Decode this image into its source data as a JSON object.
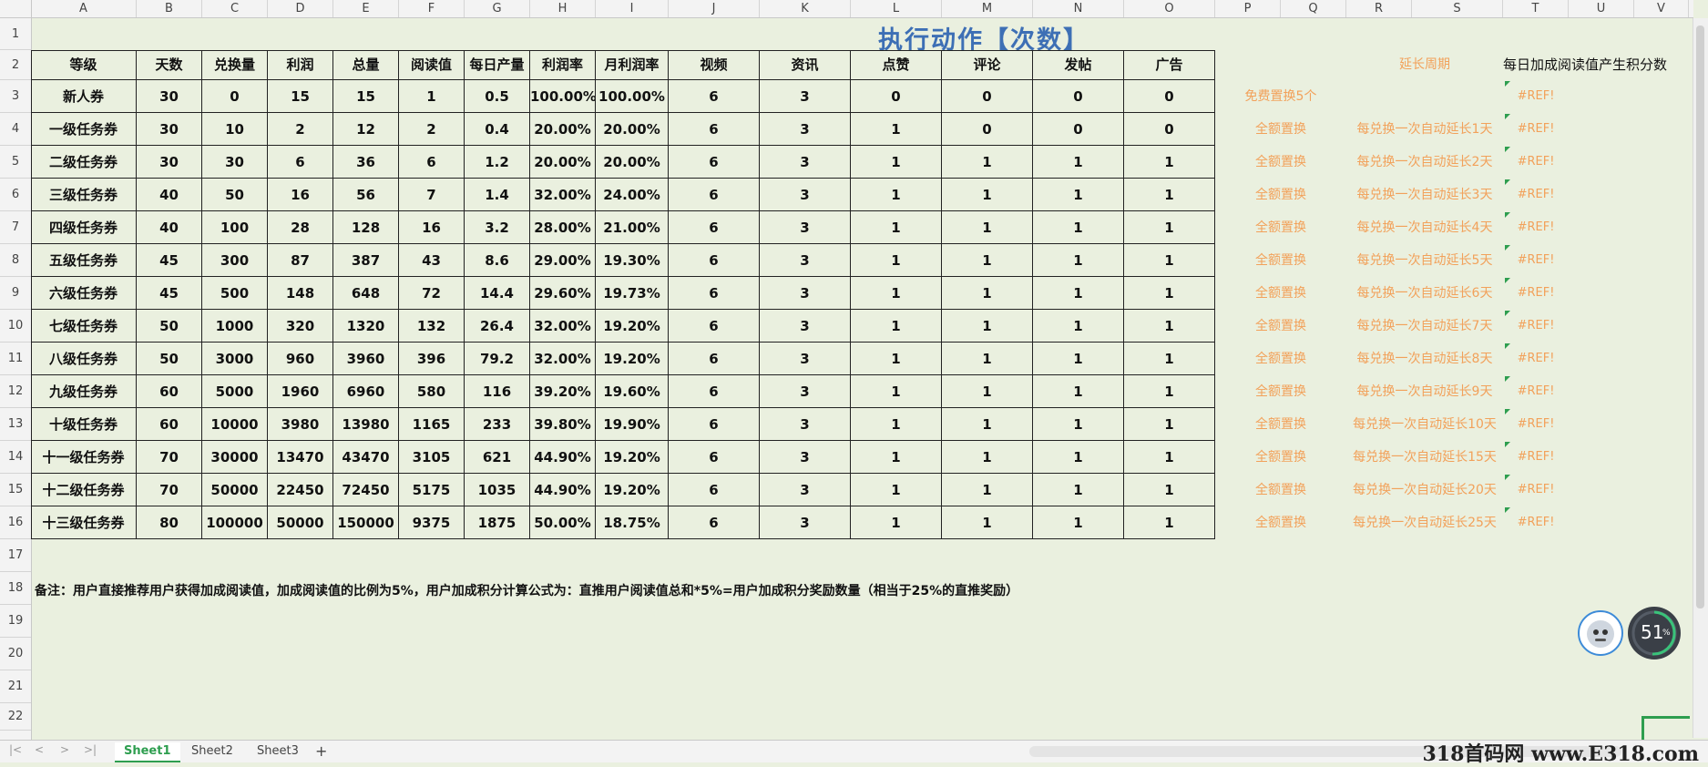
{
  "sheet": {
    "columns": [
      "A",
      "B",
      "C",
      "D",
      "E",
      "F",
      "G",
      "H",
      "I",
      "J",
      "K",
      "L",
      "M",
      "N",
      "O",
      "P",
      "Q",
      "R",
      "S",
      "T",
      "U",
      "V"
    ],
    "rows": [
      "1",
      "2",
      "3",
      "4",
      "5",
      "6",
      "7",
      "8",
      "9",
      "10",
      "11",
      "12",
      "13",
      "14",
      "15",
      "16",
      "17",
      "18",
      "19",
      "20",
      "21",
      "22"
    ],
    "title": "执行动作【次数】",
    "headers": [
      "等级",
      "天数",
      "兑换量",
      "利润",
      "总量",
      "阅读值",
      "每日产量",
      "利润率",
      "月利润率",
      "视频",
      "资讯",
      "点赞",
      "评论",
      "发帖",
      "广告"
    ],
    "side_headers": {
      "extend_period": "延长周期",
      "daily_bonus": "每日加成阅读值产生积分数"
    },
    "table": [
      {
        "level": "新人券",
        "days": "30",
        "exchange": "0",
        "profit": "15",
        "total": "15",
        "read": "1",
        "daily": "0.5",
        "rate": "100.00%",
        "mrate": "100.00%",
        "video": "6",
        "news": "3",
        "like": "0",
        "comment": "0",
        "post": "0",
        "ad": "0",
        "replace": "免费置换5个",
        "extend": "",
        "ref": "#REF!"
      },
      {
        "level": "一级任务券",
        "days": "30",
        "exchange": "10",
        "profit": "2",
        "total": "12",
        "read": "2",
        "daily": "0.4",
        "rate": "20.00%",
        "mrate": "20.00%",
        "video": "6",
        "news": "3",
        "like": "1",
        "comment": "0",
        "post": "0",
        "ad": "0",
        "replace": "全额置换",
        "extend": "每兑换一次自动延长1天",
        "ref": "#REF!"
      },
      {
        "level": "二级任务券",
        "days": "30",
        "exchange": "30",
        "profit": "6",
        "total": "36",
        "read": "6",
        "daily": "1.2",
        "rate": "20.00%",
        "mrate": "20.00%",
        "video": "6",
        "news": "3",
        "like": "1",
        "comment": "1",
        "post": "1",
        "ad": "1",
        "replace": "全额置换",
        "extend": "每兑换一次自动延长2天",
        "ref": "#REF!"
      },
      {
        "level": "三级任务券",
        "days": "40",
        "exchange": "50",
        "profit": "16",
        "total": "56",
        "read": "7",
        "daily": "1.4",
        "rate": "32.00%",
        "mrate": "24.00%",
        "video": "6",
        "news": "3",
        "like": "1",
        "comment": "1",
        "post": "1",
        "ad": "1",
        "replace": "全额置换",
        "extend": "每兑换一次自动延长3天",
        "ref": "#REF!"
      },
      {
        "level": "四级任务券",
        "days": "40",
        "exchange": "100",
        "profit": "28",
        "total": "128",
        "read": "16",
        "daily": "3.2",
        "rate": "28.00%",
        "mrate": "21.00%",
        "video": "6",
        "news": "3",
        "like": "1",
        "comment": "1",
        "post": "1",
        "ad": "1",
        "replace": "全额置换",
        "extend": "每兑换一次自动延长4天",
        "ref": "#REF!"
      },
      {
        "level": "五级任务券",
        "days": "45",
        "exchange": "300",
        "profit": "87",
        "total": "387",
        "read": "43",
        "daily": "8.6",
        "rate": "29.00%",
        "mrate": "19.30%",
        "video": "6",
        "news": "3",
        "like": "1",
        "comment": "1",
        "post": "1",
        "ad": "1",
        "replace": "全额置换",
        "extend": "每兑换一次自动延长5天",
        "ref": "#REF!"
      },
      {
        "level": "六级任务券",
        "days": "45",
        "exchange": "500",
        "profit": "148",
        "total": "648",
        "read": "72",
        "daily": "14.4",
        "rate": "29.60%",
        "mrate": "19.73%",
        "video": "6",
        "news": "3",
        "like": "1",
        "comment": "1",
        "post": "1",
        "ad": "1",
        "replace": "全额置换",
        "extend": "每兑换一次自动延长6天",
        "ref": "#REF!"
      },
      {
        "level": "七级任务券",
        "days": "50",
        "exchange": "1000",
        "profit": "320",
        "total": "1320",
        "read": "132",
        "daily": "26.4",
        "rate": "32.00%",
        "mrate": "19.20%",
        "video": "6",
        "news": "3",
        "like": "1",
        "comment": "1",
        "post": "1",
        "ad": "1",
        "replace": "全额置换",
        "extend": "每兑换一次自动延长7天",
        "ref": "#REF!"
      },
      {
        "level": "八级任务券",
        "days": "50",
        "exchange": "3000",
        "profit": "960",
        "total": "3960",
        "read": "396",
        "daily": "79.2",
        "rate": "32.00%",
        "mrate": "19.20%",
        "video": "6",
        "news": "3",
        "like": "1",
        "comment": "1",
        "post": "1",
        "ad": "1",
        "replace": "全额置换",
        "extend": "每兑换一次自动延长8天",
        "ref": "#REF!"
      },
      {
        "level": "九级任务券",
        "days": "60",
        "exchange": "5000",
        "profit": "1960",
        "total": "6960",
        "read": "580",
        "daily": "116",
        "rate": "39.20%",
        "mrate": "19.60%",
        "video": "6",
        "news": "3",
        "like": "1",
        "comment": "1",
        "post": "1",
        "ad": "1",
        "replace": "全额置换",
        "extend": "每兑换一次自动延长9天",
        "ref": "#REF!"
      },
      {
        "level": "十级任务券",
        "days": "60",
        "exchange": "10000",
        "profit": "3980",
        "total": "13980",
        "read": "1165",
        "daily": "233",
        "rate": "39.80%",
        "mrate": "19.90%",
        "video": "6",
        "news": "3",
        "like": "1",
        "comment": "1",
        "post": "1",
        "ad": "1",
        "replace": "全额置换",
        "extend": "每兑换一次自动延长10天",
        "ref": "#REF!"
      },
      {
        "level": "十一级任务券",
        "days": "70",
        "exchange": "30000",
        "profit": "13470",
        "total": "43470",
        "read": "3105",
        "daily": "621",
        "rate": "44.90%",
        "mrate": "19.20%",
        "video": "6",
        "news": "3",
        "like": "1",
        "comment": "1",
        "post": "1",
        "ad": "1",
        "replace": "全额置换",
        "extend": "每兑换一次自动延长15天",
        "ref": "#REF!"
      },
      {
        "level": "十二级任务券",
        "days": "70",
        "exchange": "50000",
        "profit": "22450",
        "total": "72450",
        "read": "5175",
        "daily": "1035",
        "rate": "44.90%",
        "mrate": "19.20%",
        "video": "6",
        "news": "3",
        "like": "1",
        "comment": "1",
        "post": "1",
        "ad": "1",
        "replace": "全额置换",
        "extend": "每兑换一次自动延长20天",
        "ref": "#REF!"
      },
      {
        "level": "十三级任务券",
        "days": "80",
        "exchange": "100000",
        "profit": "50000",
        "total": "150000",
        "read": "9375",
        "daily": "1875",
        "rate": "50.00%",
        "mrate": "18.75%",
        "video": "6",
        "news": "3",
        "like": "1",
        "comment": "1",
        "post": "1",
        "ad": "1",
        "replace": "全额置换",
        "extend": "每兑换一次自动延长25天",
        "ref": "#REF!"
      }
    ],
    "note": "备注：用户直接推荐用户获得加成阅读值，加成阅读值的比例为5%，用户加成积分计算公式为：直推用户阅读值总和*5%=用户加成积分奖励数量（相当于25%的直推奖励）"
  },
  "tabs": [
    "Sheet1",
    "Sheet2",
    "Sheet3"
  ],
  "add_tab": "+",
  "widget": {
    "percent": "51",
    "percent_sign": "%"
  },
  "watermark": "318首码网 www.E318.com",
  "colors": {
    "title": "#3d6fb5",
    "accent": "#f2a15a",
    "active_tab": "#2e9e4f",
    "bg": "#eaf0df"
  }
}
